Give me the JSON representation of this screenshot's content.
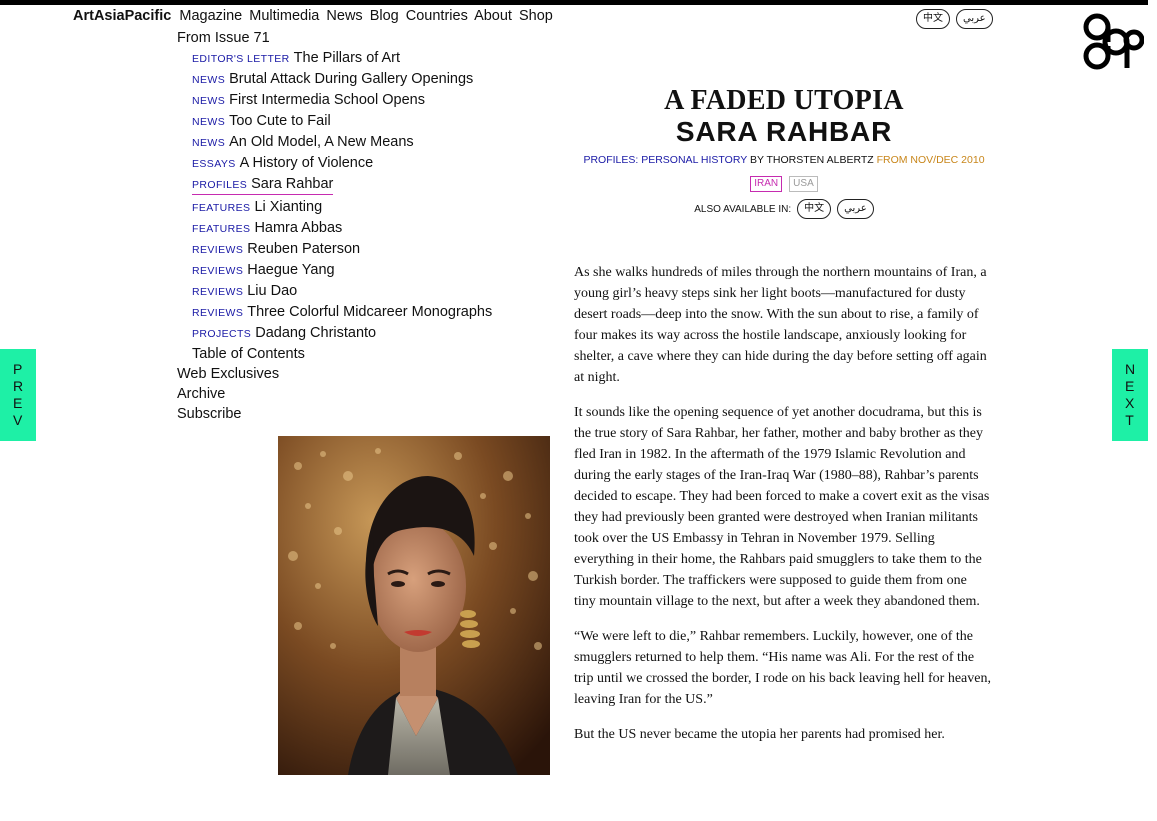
{
  "nav": {
    "brand": "ArtAsiaPacific",
    "items": [
      "Magazine",
      "Multimedia",
      "News",
      "Blog",
      "Countries",
      "About",
      "Shop"
    ]
  },
  "issue_label": "From Issue 71",
  "articles": [
    {
      "category": "Editor's Letter",
      "title": "The Pillars of Art"
    },
    {
      "category": "News",
      "title": "Brutal Attack During Gallery Openings"
    },
    {
      "category": "News",
      "title": "First Intermedia School Opens"
    },
    {
      "category": "News",
      "title": "Too Cute to Fail"
    },
    {
      "category": "News",
      "title": "An Old Model, A New Means"
    },
    {
      "category": "Essays",
      "title": "A History of Violence"
    },
    {
      "category": "Profiles",
      "title": "Sara Rahbar"
    },
    {
      "category": "Features",
      "title": "Li Xianting"
    },
    {
      "category": "Features",
      "title": "Hamra Abbas"
    },
    {
      "category": "Reviews",
      "title": "Reuben Paterson"
    },
    {
      "category": "Reviews",
      "title": "Haegue Yang"
    },
    {
      "category": "Reviews",
      "title": "Liu Dao"
    },
    {
      "category": "Reviews",
      "title": "Three Colorful Midcareer Monographs"
    },
    {
      "category": "Projects",
      "title": "Dadang Christanto"
    }
  ],
  "toc_label": "Table of Contents",
  "extra_links": [
    "Web Exclusives",
    "Archive",
    "Subscribe"
  ],
  "language_links": [
    "中文",
    "عربي"
  ],
  "side_nav": {
    "prev": "PREV",
    "next": "NEXT"
  },
  "headline": {
    "title": "A FADED UTOPIA",
    "subject": "SARA RAHBAR",
    "section": "Profiles: Personal History",
    "byline": "by Thorsten Albertz",
    "issue": "from Nov/Dec 2010"
  },
  "tags": [
    "IRAN",
    "USA"
  ],
  "also_available_label": "ALSO AVAILABLE IN:",
  "paragraphs": [
    "As she walks hundreds of miles through the northern mountains of Iran, a young girl’s heavy steps sink her light boots—manufactured for dusty desert roads—deep into the snow. With the sun about to rise, a family of four makes its way across the hostile landscape, anxiously looking for shelter, a cave where they can hide during the day before setting off again at night.",
    "It sounds like the opening sequence of yet another docudrama, but this is the true story of Sara Rahbar, her father, mother and baby brother as they fled Iran in 1982. In the aftermath of the 1979 Islamic Revolution and during the early stages of the Iran-Iraq War (1980–88), Rahbar’s parents decided to escape. They had been forced to make a covert exit as the visas they had previously been granted were destroyed when Iranian militants took over the US Embassy in Tehran in November 1979. Selling everything in their home, the Rahbars paid smugglers to take them to the Turkish border. The traffickers were supposed to guide them from one tiny mountain village to the next, but after a week they abandoned them.",
    "“We were left to die,” Rahbar remembers. Luckily, however, one of the smugglers returned to help them. “His name was Ali. For the rest of the trip until we crossed the border, I rode on his back leaving hell for heaven, leaving Iran for the US.”",
    "But the US never became the utopia her parents had promised her."
  ],
  "colors": {
    "category_blue": "#1a1aa6",
    "tag_magenta": "#c62bb0",
    "issue_orange": "#c8861a",
    "side_tab_green": "#1ef0a6"
  }
}
